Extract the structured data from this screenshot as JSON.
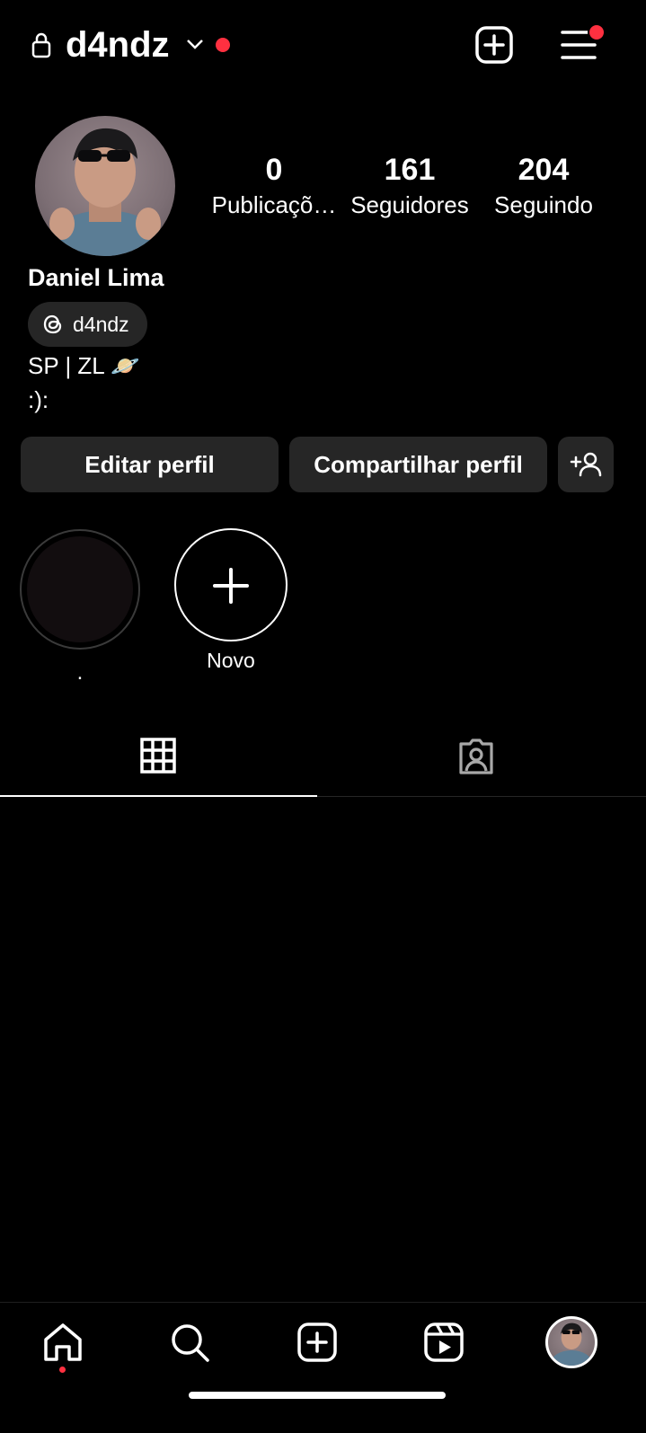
{
  "header": {
    "username": "d4ndz",
    "icons": [
      "lock-icon",
      "chevron-down-icon",
      "create-post-icon",
      "menu-icon"
    ],
    "notification_color": "#ff3040"
  },
  "profile": {
    "stats": [
      {
        "value": "0",
        "label": "Publicaçõ…"
      },
      {
        "value": "161",
        "label": "Seguidores"
      },
      {
        "value": "204",
        "label": "Seguindo"
      }
    ],
    "full_name": "Daniel Lima",
    "threads_handle": "d4ndz",
    "bio_line1": "SP | ZL 🪐",
    "bio_line2": ":):"
  },
  "actions": {
    "edit_label": "Editar perfil",
    "share_label": "Compartilhar perfil"
  },
  "highlights": [
    {
      "label": "."
    },
    {
      "label": "Novo"
    }
  ],
  "tabs": [
    "grid-icon",
    "tagged-icon"
  ],
  "bottom_nav": [
    "home-icon",
    "search-icon",
    "create-icon",
    "reels-icon",
    "profile-avatar"
  ],
  "colors": {
    "background": "#000000",
    "surface": "#262626",
    "accent_red": "#ff3040"
  }
}
